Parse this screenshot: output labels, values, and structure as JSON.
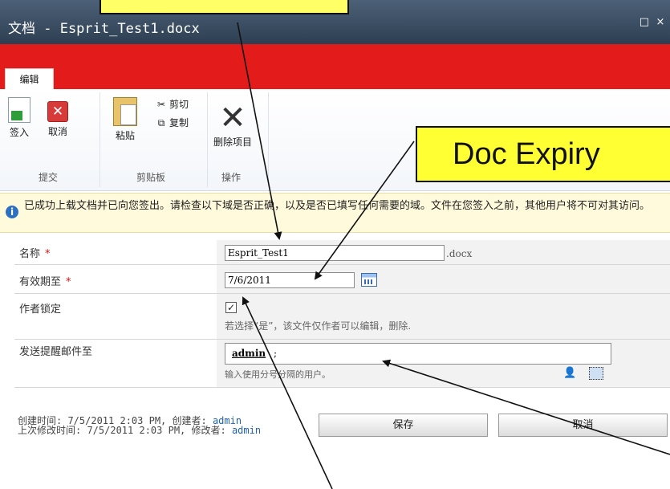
{
  "window": {
    "title": "文档 - Esprit_Test1.docx",
    "maximize_icon": "□",
    "close_icon": "×"
  },
  "ribbon": {
    "tab_label": "编辑",
    "checkin_label": "签入",
    "cancel_label": "取消",
    "paste_label": "粘贴",
    "cut_label": "剪切",
    "copy_label": "复制",
    "delete_label": "删除项目",
    "group_submit": "提交",
    "group_clipboard": "剪贴板",
    "group_actions": "操作"
  },
  "callout": {
    "text": "Doc Expiry"
  },
  "notice": {
    "text": "已成功上载文档并已向您签出。请检查以下域是否正确，以及是否已填写任何需要的域。文件在您签入之前，其他用户将不可对其访问。"
  },
  "form": {
    "name_label": "名称",
    "name_value": "Esprit_Test1",
    "name_ext": ".docx",
    "expiry_label": "有效期至",
    "expiry_value": "7/6/2011",
    "lock_label": "作者锁定",
    "lock_checked": true,
    "lock_mark": "✓",
    "lock_hint": "若选择“是”，该文件仅作者可以编辑，删除.",
    "notify_label": "发送提醒邮件至",
    "notify_value": "admin",
    "notify_suffix": ";",
    "notify_hint": "输入使用分号分隔的用户。",
    "required_mark": "*"
  },
  "footer": {
    "created": "创建时间: 7/5/2011 2:03 PM, 创建者:",
    "created_by": "admin",
    "modified": "上次修改时间: 7/5/2011 2:03 PM, 修改者:",
    "modified_by": "admin",
    "save_label": "保存",
    "cancel_label": "取消"
  },
  "colors": {
    "title_bar": "#3b4d62",
    "red_band": "#e41b1b",
    "callout": "#ffff33",
    "link": "#1f63b5"
  }
}
